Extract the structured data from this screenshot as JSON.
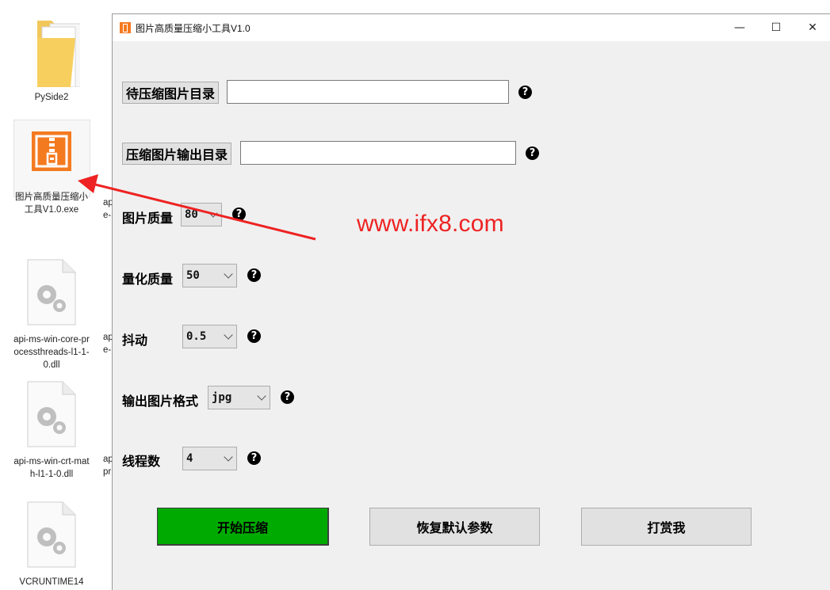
{
  "desktop": {
    "icons": [
      {
        "label": "PySide2"
      },
      {
        "label": "图片高质量压缩小工具V1.0.exe"
      },
      {
        "label": "api-ms-win-core-processthreads-l1-1-0.dll"
      },
      {
        "label": "api-ms-win-crt-math-l1-1-0.dll"
      },
      {
        "label": "VCRUNTIME14"
      }
    ],
    "partial_labels": [
      "ap",
      "e-",
      "ap",
      "e-",
      "ap",
      "pr"
    ]
  },
  "watermark": "www.ifx8.com",
  "window": {
    "title": "图片高质量压缩小工具V1.0",
    "controls": {
      "minimize": "—",
      "maximize": "☐",
      "close": "✕"
    }
  },
  "form": {
    "input_dir_label": "待压缩图片目录",
    "input_dir_value": "",
    "output_dir_label": "压缩图片输出目录",
    "output_dir_value": "",
    "quality_label": "图片质量",
    "quality_value": "80",
    "quantize_label": "量化质量",
    "quantize_value": "50",
    "dither_label": "抖动",
    "dither_value": "0.5",
    "format_label": "输出图片格式",
    "format_value": "jpg",
    "threads_label": "线程数",
    "threads_value": "4",
    "help_glyph": "?"
  },
  "actions": {
    "start": "开始压缩",
    "reset": "恢复默认参数",
    "donate": "打赏我"
  },
  "colors": {
    "accent_orange": "#f47a20",
    "start_green": "#00aa00",
    "watermark_red": "#ee2222"
  }
}
